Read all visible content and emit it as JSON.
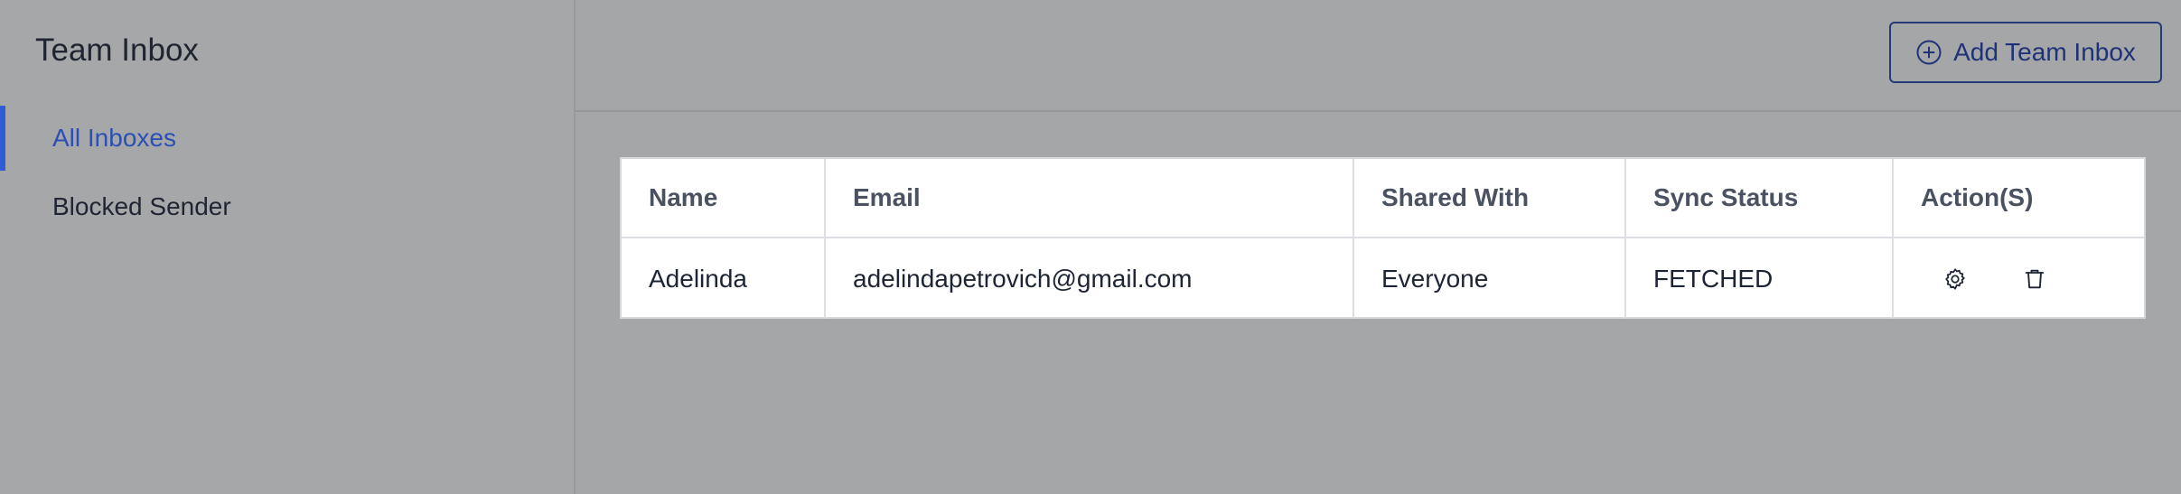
{
  "sidebar": {
    "title": "Team Inbox",
    "items": [
      {
        "label": "All Inboxes",
        "active": true
      },
      {
        "label": "Blocked Sender",
        "active": false
      }
    ]
  },
  "header": {
    "add_button_label": "Add Team Inbox",
    "add_button_icon": "plus-circle-icon"
  },
  "table": {
    "columns": [
      "Name",
      "Email",
      "Shared With",
      "Sync Status",
      "Action(S)"
    ],
    "rows": [
      {
        "name": "Adelinda",
        "email": "adelindapetrovich@gmail.com",
        "shared_with": "Everyone",
        "sync_status": "FETCHED",
        "actions": [
          "gear-icon",
          "trash-icon"
        ]
      }
    ]
  },
  "colors": {
    "accent": "#2f5bd6",
    "button_border": "#253a78",
    "overlay_bg": "#a5a6a8"
  }
}
